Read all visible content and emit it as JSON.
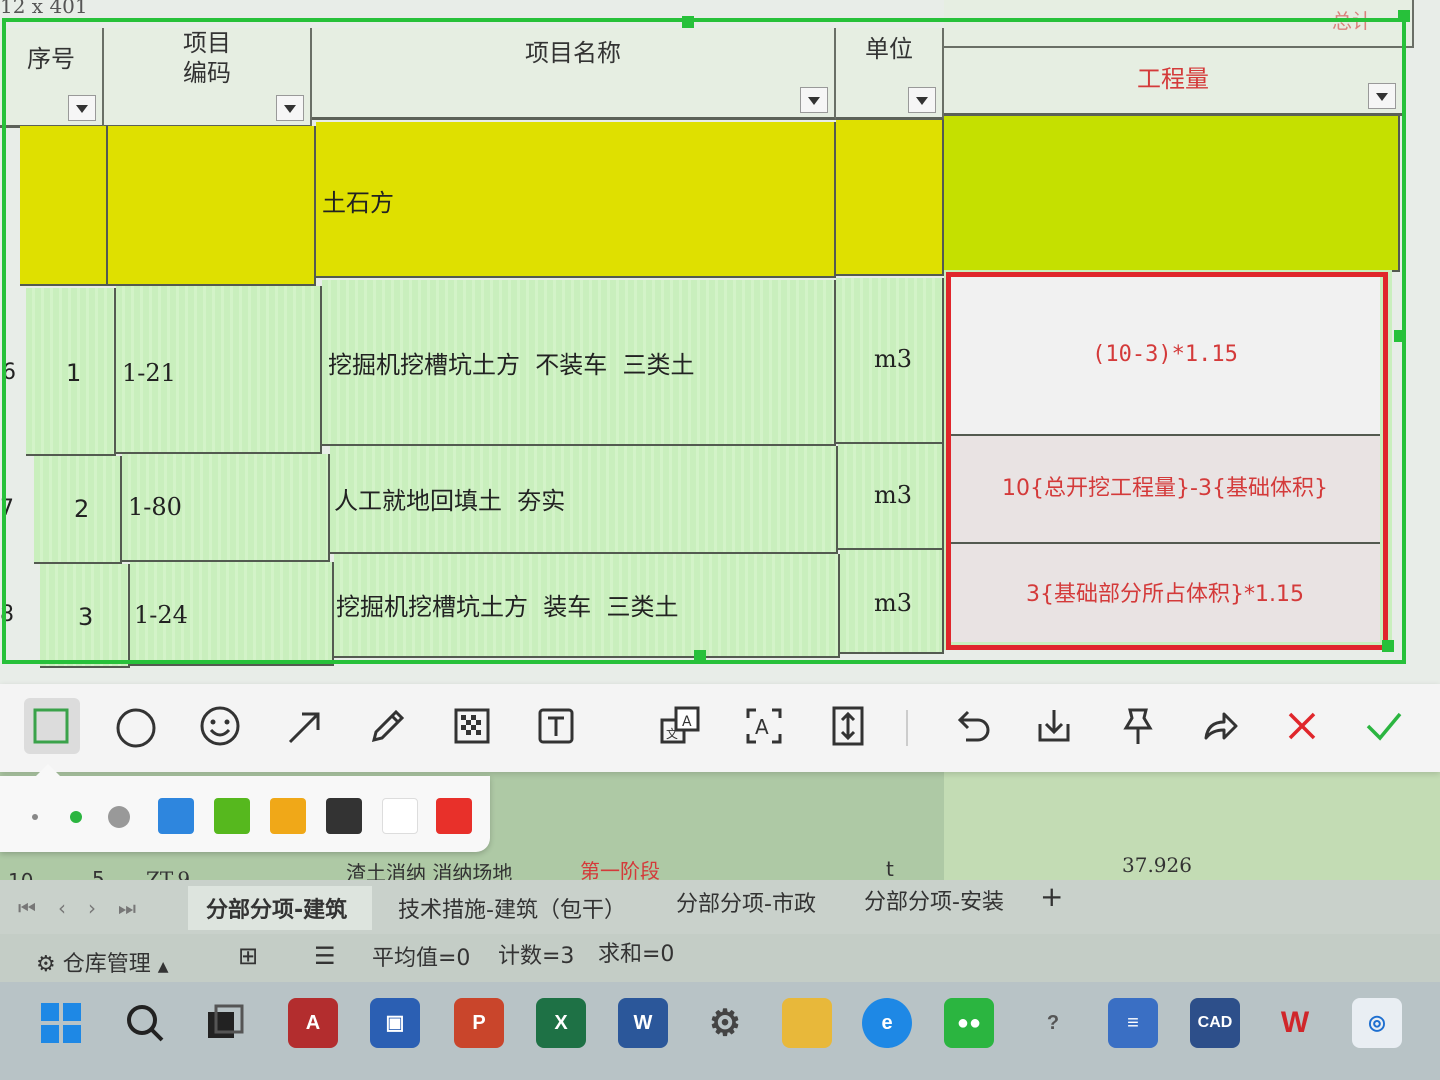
{
  "sheet": {
    "top_name_fragment": "12 x 401",
    "headers": {
      "seq": "序号",
      "code": "项目\n编码",
      "name": "项目名称",
      "unit": "单位",
      "total_fragment": "总计",
      "quantity": "工程量"
    },
    "section_row": {
      "name": "土石方"
    },
    "rows": [
      {
        "rownum": "6",
        "seq": "1",
        "code": "1-21",
        "name": "挖掘机挖槽坑土方  不装车  三类土",
        "unit": "m3",
        "quantity": "(10-3)*1.15"
      },
      {
        "rownum": "7",
        "seq": "2",
        "code": "1-80",
        "name": "人工就地回填土  夯实",
        "unit": "m3",
        "quantity": "10{总开挖工程量}-3{基础体积}"
      },
      {
        "rownum": "8",
        "seq": "3",
        "code": "1-24",
        "name": "挖掘机挖槽坑土方  装车  三类土",
        "unit": "m3",
        "quantity": "3{基础部分所占体积}*1.15"
      }
    ],
    "partial_row": {
      "rownum": "10",
      "seq": "5",
      "code": "ZT-9",
      "name": "渣土消纳  消纳场地",
      "name_red": "第一阶段",
      "unit": "t",
      "quantity": "37.926"
    }
  },
  "toolbar": {
    "tools": [
      "rectangle-icon",
      "circle-icon",
      "emoji-icon",
      "arrow-icon",
      "pencil-icon",
      "mosaic-icon",
      "text-icon",
      "translate-icon",
      "ocr-icon",
      "long-screenshot-icon",
      "undo-icon",
      "save-icon",
      "pin-icon",
      "share-icon",
      "cancel-icon",
      "confirm-icon"
    ],
    "colors": [
      "#2e86de",
      "#56b81e",
      "#f0a818",
      "#333333",
      "#ffffff",
      "#e8302a"
    ]
  },
  "tabs": {
    "items": [
      "分部分项-建筑",
      "技术措施-建筑（包干）",
      "分部分项-市政",
      "分部分项-安装"
    ],
    "add": "+"
  },
  "status": {
    "warehouse": "仓库管理",
    "average": "平均值=0",
    "count": "计数=3",
    "sum": "求和=0"
  },
  "taskbar": {
    "apps": [
      "windows-start-icon",
      "search-icon",
      "task-view-icon",
      "access-icon",
      "store-icon",
      "powerpoint-icon",
      "excel-icon",
      "word-icon",
      "settings-icon",
      "file-explorer-icon",
      "edge-icon",
      "wechat-icon",
      "help-icon",
      "notepad-icon",
      "cad-icon",
      "wps-icon",
      "app-icon"
    ]
  }
}
